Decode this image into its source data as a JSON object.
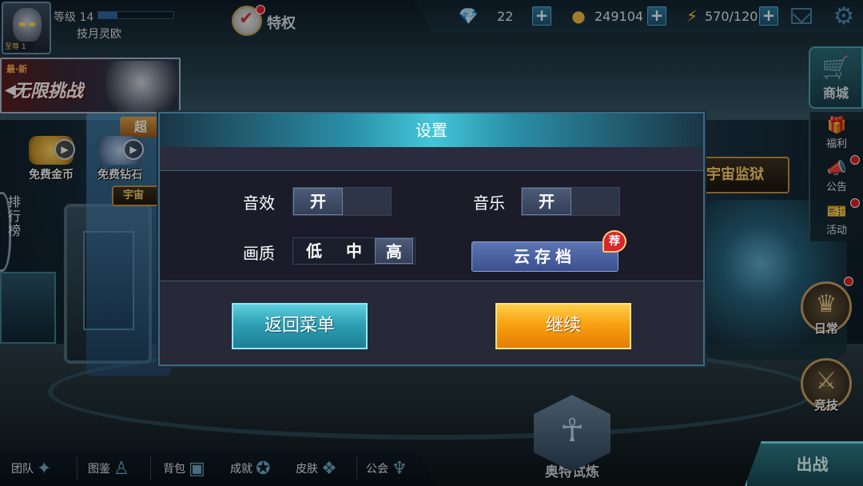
{
  "hud": {
    "level_label": "等级 14",
    "level_progress": 0.25,
    "player_name": "技月灵欧",
    "avatar_rank": "至尊 1",
    "privilege_label": "特权",
    "gems": "22",
    "gold": "249104",
    "energy": "570/120",
    "plus_label": "+"
  },
  "left": {
    "challenge_tag": "最·新",
    "challenge_title": "无限挑战",
    "free_gold": "免费金币",
    "free_gems": "免费钻石",
    "super_tag": "超",
    "cosmos_left": "宇宙",
    "rank_board": "排行榜"
  },
  "cosmos_prison": "宇宙监狱",
  "right_menu": {
    "shop": "商城",
    "welfare": "福利",
    "notice": "公告",
    "events": "活动",
    "daily": "日常",
    "pvp": "竞技"
  },
  "bottom": {
    "items": [
      {
        "label": "团队",
        "icon": "team-icon"
      },
      {
        "label": "图鉴",
        "icon": "codex-icon"
      },
      {
        "label": "背包",
        "icon": "bag-icon"
      },
      {
        "label": "成就",
        "icon": "achievement-icon"
      },
      {
        "label": "皮肤",
        "icon": "skin-icon"
      },
      {
        "label": "公会",
        "icon": "guild-icon"
      }
    ],
    "trial": "奥特试炼",
    "fight": "出战"
  },
  "settings": {
    "title": "设置",
    "sound_label": "音效",
    "sound_value": "开",
    "music_label": "音乐",
    "music_value": "开",
    "quality_label": "画质",
    "quality_options": [
      "低",
      "中",
      "高"
    ],
    "quality_selected": "高",
    "cloud_save": "云存档",
    "cloud_badge": "荐",
    "back_to_menu": "返回菜单",
    "continue": "继续"
  },
  "colors": {
    "accent_cyan": "#44c6d8",
    "accent_orange": "#f8a112",
    "notify_red": "#e52121"
  }
}
